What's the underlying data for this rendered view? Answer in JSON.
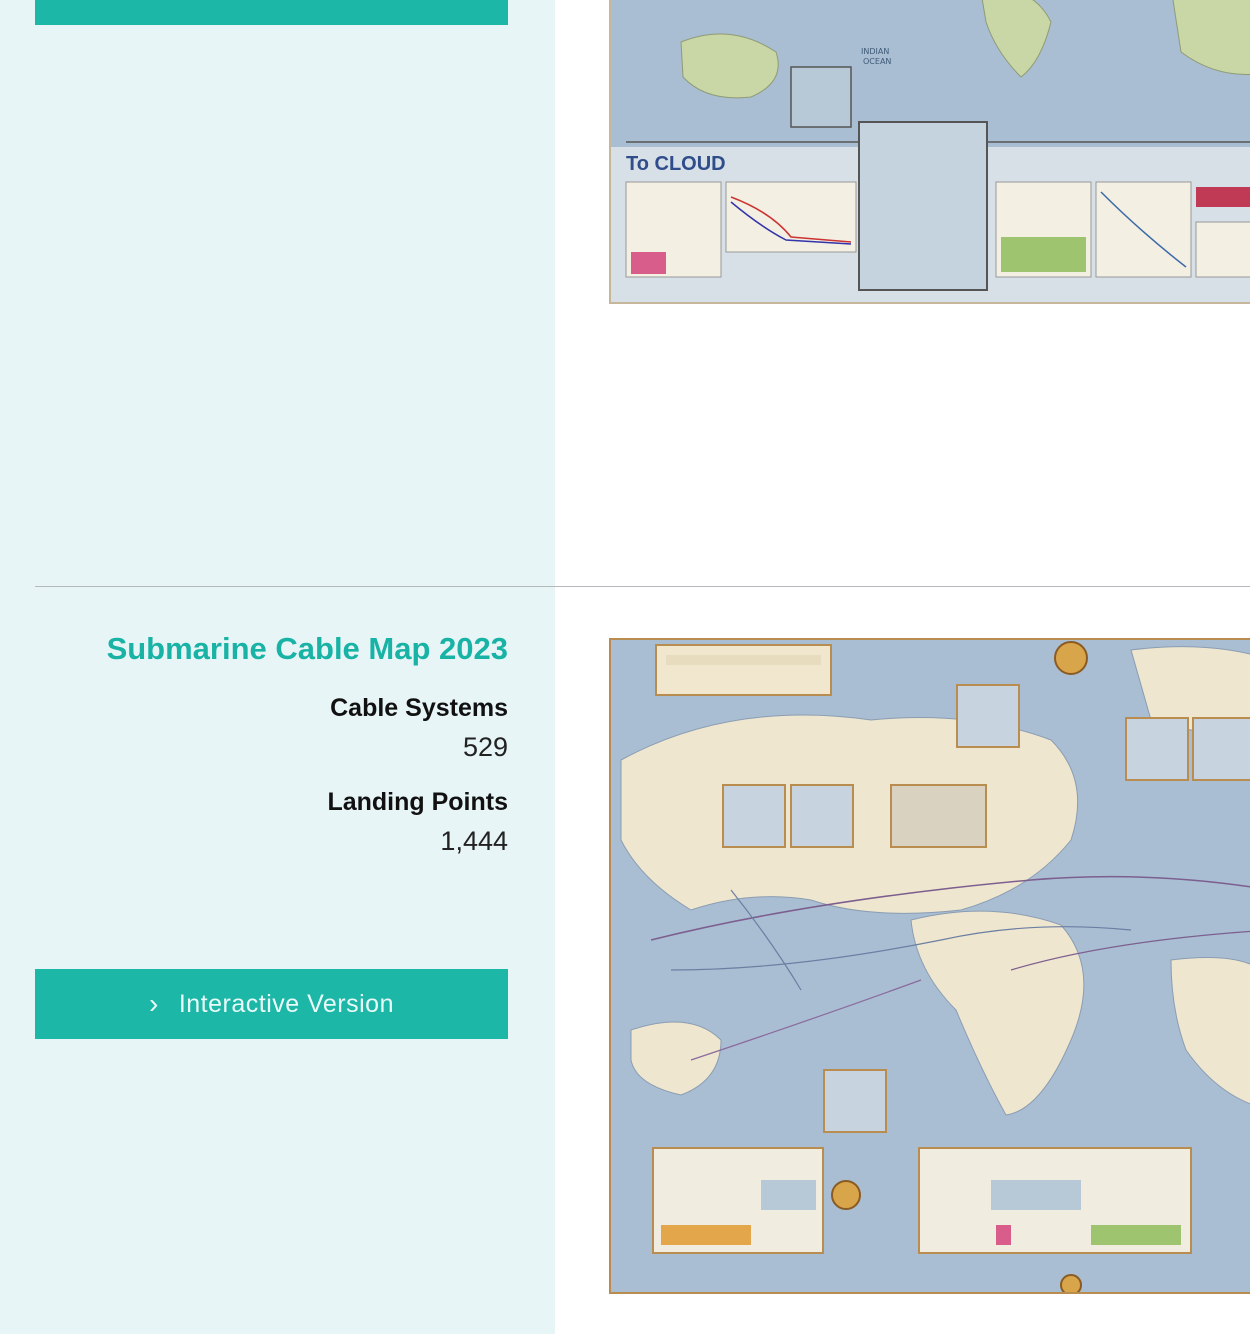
{
  "top_entry": {
    "button_label": "",
    "thumbnail_caption": "To CLOUD"
  },
  "entry": {
    "title": "Submarine Cable Map 2023",
    "stats": [
      {
        "label": "Cable Systems",
        "value": "529"
      },
      {
        "label": "Landing Points",
        "value": "1,444"
      }
    ],
    "button_label": "Interactive Version",
    "button_icon": "chevron-right-icon"
  },
  "colors": {
    "accent": "#1db7a8",
    "title": "#19b3a6",
    "panel_bg": "#e8f5f7",
    "map_ocean": "#a9bed3",
    "map_land": "#efe6cf",
    "frame": "#b98c4f"
  }
}
